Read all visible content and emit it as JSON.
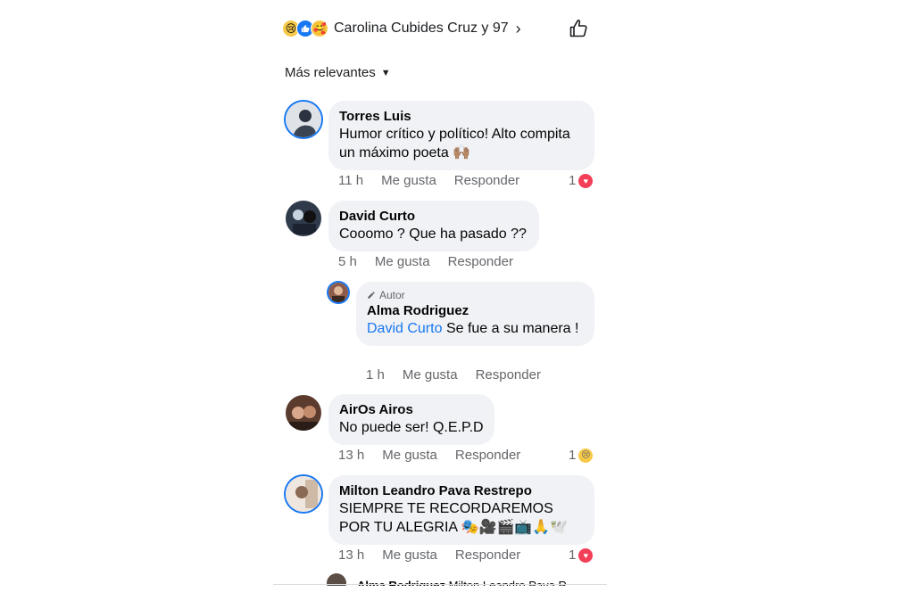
{
  "header": {
    "reaction_icons": [
      "sad-icon",
      "like-icon",
      "care-icon"
    ],
    "reactors_label": "Carolina Cubides Cruz y 97",
    "sort_label": "Más relevantes"
  },
  "comments": [
    {
      "author": "Torres Luis",
      "text": "Humor crítico y político! Alto compita un máximo poeta 🙌🏽",
      "time": "11 h",
      "like_label": "Me gusta",
      "reply_label": "Responder",
      "reaction_count": "1",
      "reaction": "love"
    },
    {
      "author": "David Curto",
      "text": "Cooomo ? Que ha pasado ??",
      "time": "5 h",
      "like_label": "Me gusta",
      "reply_label": "Responder"
    },
    {
      "author_tag": "Autor",
      "author": "Alma Rodriguez",
      "mention": "David Curto",
      "text": "Se fue a su manera !",
      "time": "1 h",
      "like_label": "Me gusta",
      "reply_label": "Responder"
    },
    {
      "author": "AirOs Airos",
      "text": "No puede ser! Q.E.P.D",
      "time": "13 h",
      "like_label": "Me gusta",
      "reply_label": "Responder",
      "reaction_count": "1",
      "reaction": "sad"
    },
    {
      "author": "Milton Leandro Pava Restrepo",
      "text": "SIEMPRE TE RECORDAREMOS POR TU ALEGRIA 🎭🎥🎬📺🙏🕊️",
      "time": "13 h",
      "like_label": "Me gusta",
      "reply_label": "Responder",
      "reaction_count": "1",
      "reaction": "love"
    }
  ],
  "partial_reply": {
    "author": "Alma Rodriguez",
    "text": "Milton Leandro Pava R..."
  },
  "colors": {
    "bubble": "#f0f2f5",
    "secondary_text": "#65676b",
    "accent": "#1877f2",
    "love": "#f33e58"
  }
}
